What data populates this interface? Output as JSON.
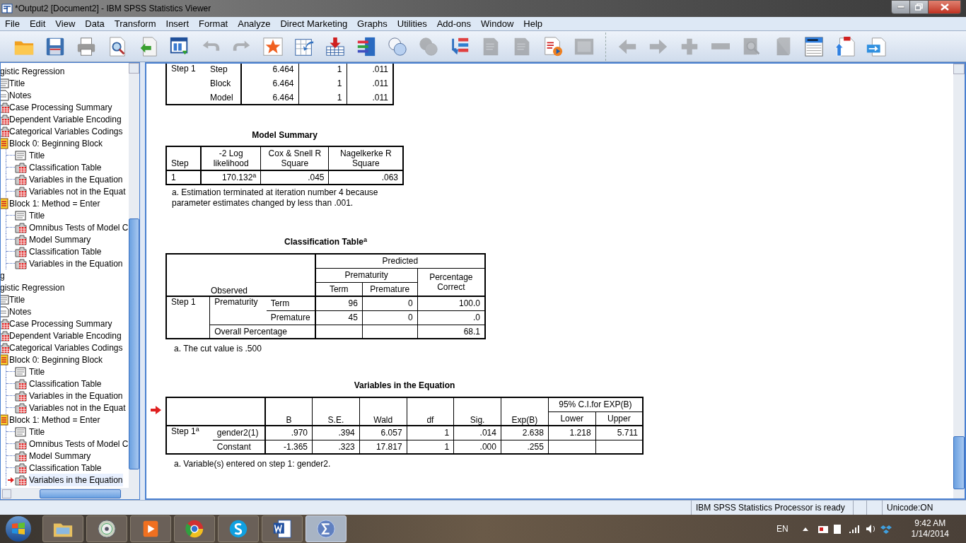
{
  "window": {
    "title": "*Output2 [Document2] - IBM SPSS Statistics Viewer"
  },
  "menu": [
    "File",
    "Edit",
    "View",
    "Data",
    "Transform",
    "Insert",
    "Format",
    "Analyze",
    "Direct Marketing",
    "Graphs",
    "Utilities",
    "Add-ons",
    "Window",
    "Help"
  ],
  "toolbar": [
    {
      "kind": "open",
      "disabled": false
    },
    {
      "kind": "save",
      "disabled": false
    },
    {
      "kind": "print",
      "disabled": false
    },
    {
      "kind": "preview",
      "disabled": false
    },
    {
      "kind": "export",
      "disabled": false
    },
    {
      "kind": "recall",
      "disabled": false
    },
    {
      "kind": "undo",
      "disabled": true
    },
    {
      "kind": "redo",
      "disabled": true
    },
    {
      "kind": "star",
      "disabled": false
    },
    {
      "kind": "goto",
      "disabled": false
    },
    {
      "kind": "insert",
      "disabled": false
    },
    {
      "kind": "variables",
      "disabled": false
    },
    {
      "kind": "circles",
      "disabled": false
    },
    {
      "kind": "circles",
      "disabled": true
    },
    {
      "kind": "outline",
      "disabled": false
    },
    {
      "kind": "doc",
      "disabled": true
    },
    {
      "kind": "doc",
      "disabled": true
    },
    {
      "kind": "docplay",
      "disabled": false
    },
    {
      "kind": "frame",
      "disabled": true
    },
    {
      "kind": "sep"
    },
    {
      "kind": "back",
      "disabled": true
    },
    {
      "kind": "forward",
      "disabled": true
    },
    {
      "kind": "plus",
      "disabled": true
    },
    {
      "kind": "minus",
      "disabled": true
    },
    {
      "kind": "zoom",
      "disabled": true
    },
    {
      "kind": "book",
      "disabled": true
    },
    {
      "kind": "window",
      "disabled": false
    },
    {
      "kind": "docup",
      "disabled": false
    },
    {
      "kind": "docswap",
      "disabled": false
    }
  ],
  "outline": [
    {
      "label": "gistic Regression",
      "children": [
        {
          "label": "Title",
          "kind": "title"
        },
        {
          "label": "Notes",
          "kind": "notes"
        },
        {
          "label": "Case Processing Summary",
          "kind": "table"
        },
        {
          "label": "Dependent Variable Encoding",
          "kind": "table"
        },
        {
          "label": "Categorical Variables Codings",
          "kind": "table"
        },
        {
          "label": "Block 0: Beginning Block",
          "kind": "block",
          "children": [
            {
              "label": "Title",
              "kind": "title",
              "current": false
            },
            {
              "label": "Classification Table",
              "kind": "table",
              "current": false
            },
            {
              "label": "Variables in the Equation",
              "kind": "table",
              "current": false
            },
            {
              "label": "Variables not in the Equat",
              "kind": "table",
              "current": false
            }
          ]
        },
        {
          "label": "Block 1: Method = Enter",
          "kind": "block",
          "children": [
            {
              "label": "Title",
              "kind": "title",
              "current": false
            },
            {
              "label": "Omnibus Tests of Model C",
              "kind": "table",
              "current": false
            },
            {
              "label": "Model Summary",
              "kind": "table",
              "current": false
            },
            {
              "label": "Classification Table",
              "kind": "table",
              "current": false
            },
            {
              "label": "Variables in the Equation",
              "kind": "table",
              "current": false
            }
          ]
        }
      ]
    },
    {
      "label": "g"
    },
    {
      "label": "gistic Regression",
      "children": [
        {
          "label": "Title",
          "kind": "title"
        },
        {
          "label": "Notes",
          "kind": "notes"
        },
        {
          "label": "Case Processing Summary",
          "kind": "table"
        },
        {
          "label": "Dependent Variable Encoding",
          "kind": "table"
        },
        {
          "label": "Categorical Variables Codings",
          "kind": "table"
        },
        {
          "label": "Block 0: Beginning Block",
          "kind": "block",
          "children": [
            {
              "label": "Title",
              "kind": "title",
              "current": false
            },
            {
              "label": "Classification Table",
              "kind": "table",
              "current": false
            },
            {
              "label": "Variables in the Equation",
              "kind": "table",
              "current": false
            },
            {
              "label": "Variables not in the Equat",
              "kind": "table",
              "current": false
            }
          ]
        },
        {
          "label": "Block 1: Method = Enter",
          "kind": "block",
          "children": [
            {
              "label": "Title",
              "kind": "title",
              "current": false
            },
            {
              "label": "Omnibus Tests of Model C",
              "kind": "table",
              "current": false
            },
            {
              "label": "Model Summary",
              "kind": "table",
              "current": false
            },
            {
              "label": "Classification Table",
              "kind": "table",
              "current": false
            },
            {
              "label": "Variables in the Equation",
              "kind": "table",
              "current": true
            }
          ]
        }
      ]
    }
  ],
  "output": [
    {
      "kind": "partial",
      "selected": false,
      "rows": [
        {
          "column_1": "Step 1",
          "column_2": "Step",
          "column_3": "6.464",
          "column_4": "1",
          "column_5": ".011"
        },
        {
          "column_2": "Block",
          "column_3": "6.464",
          "column_4": "1",
          "column_5": ".011"
        },
        {
          "column_2": "Model",
          "column_3": "6.464",
          "column_4": "1",
          "column_5": ".011"
        }
      ]
    },
    {
      "kind": "model_summary",
      "selected": false,
      "title": "Model Summary",
      "columns": [
        "Step",
        "-2 Log likelihood",
        "Cox & Snell R Square",
        "Nagelkerke R Square"
      ],
      "rows": [
        [
          "1",
          "170.132$^{a}$",
          ".045",
          ".063"
        ]
      ],
      "footnote": "a. Estimation terminated at iteration number 4 because parameter estimates changed by less than .001."
    },
    {
      "kind": "classification",
      "selected": false,
      "title": "Classification Table$^{a}$",
      "observed": "Observed",
      "predicted": "Predicted",
      "variable": "Prematurity",
      "categories": [
        "Term",
        "Premature"
      ],
      "percent": "Percentage Correct",
      "step": "Step 1",
      "row_variable": "Prematurity",
      "rows": [
        {
          "label": "Term",
          "values": [
            "96",
            "0",
            "100.0"
          ]
        },
        {
          "label": "Premature",
          "values": [
            "45",
            "0",
            ".0"
          ]
        }
      ],
      "overall": {
        "label": "Overall Percentage",
        "value": "68.1"
      },
      "footnote": "a. The cut value is .500"
    },
    {
      "kind": "variables",
      "selected": true,
      "title": "Variables in the Equation",
      "columns": [
        "B",
        "S.E.",
        "Wald",
        "df",
        "Sig.",
        "Exp(B)"
      ],
      "ci": "95% C.I.for EXP(B)",
      "ci_columns": [
        "Lower",
        "Upper"
      ],
      "step": "Step 1$^{a}$",
      "rows": [
        {
          "label": "gender2(1)",
          "values": [
            ".970",
            ".394",
            "6.057",
            "1",
            ".014",
            "2.638",
            "1.218",
            "5.711"
          ]
        },
        {
          "label": "Constant",
          "values": [
            "-1.365",
            ".323",
            "17.817",
            "1",
            ".000",
            ".255"
          ]
        }
      ],
      "footnote": "a. Variable(s) entered on step 1: gender2."
    }
  ],
  "status_bar": {
    "message": "IBM SPSS Statistics Processor is ready",
    "encoding": "Unicode:ON"
  },
  "taskbar": {
    "apps": [
      {
        "kind": "explorer",
        "selected": false
      },
      {
        "kind": "disc",
        "selected": false
      },
      {
        "kind": "media",
        "selected": false
      },
      {
        "kind": "browser",
        "selected": false
      },
      {
        "kind": "chat",
        "selected": false
      },
      {
        "kind": "word",
        "selected": false
      },
      {
        "kind": "sigma",
        "selected": true
      }
    ],
    "language": "EN",
    "time": "9:42 AM",
    "date": "1/14/2014"
  }
}
